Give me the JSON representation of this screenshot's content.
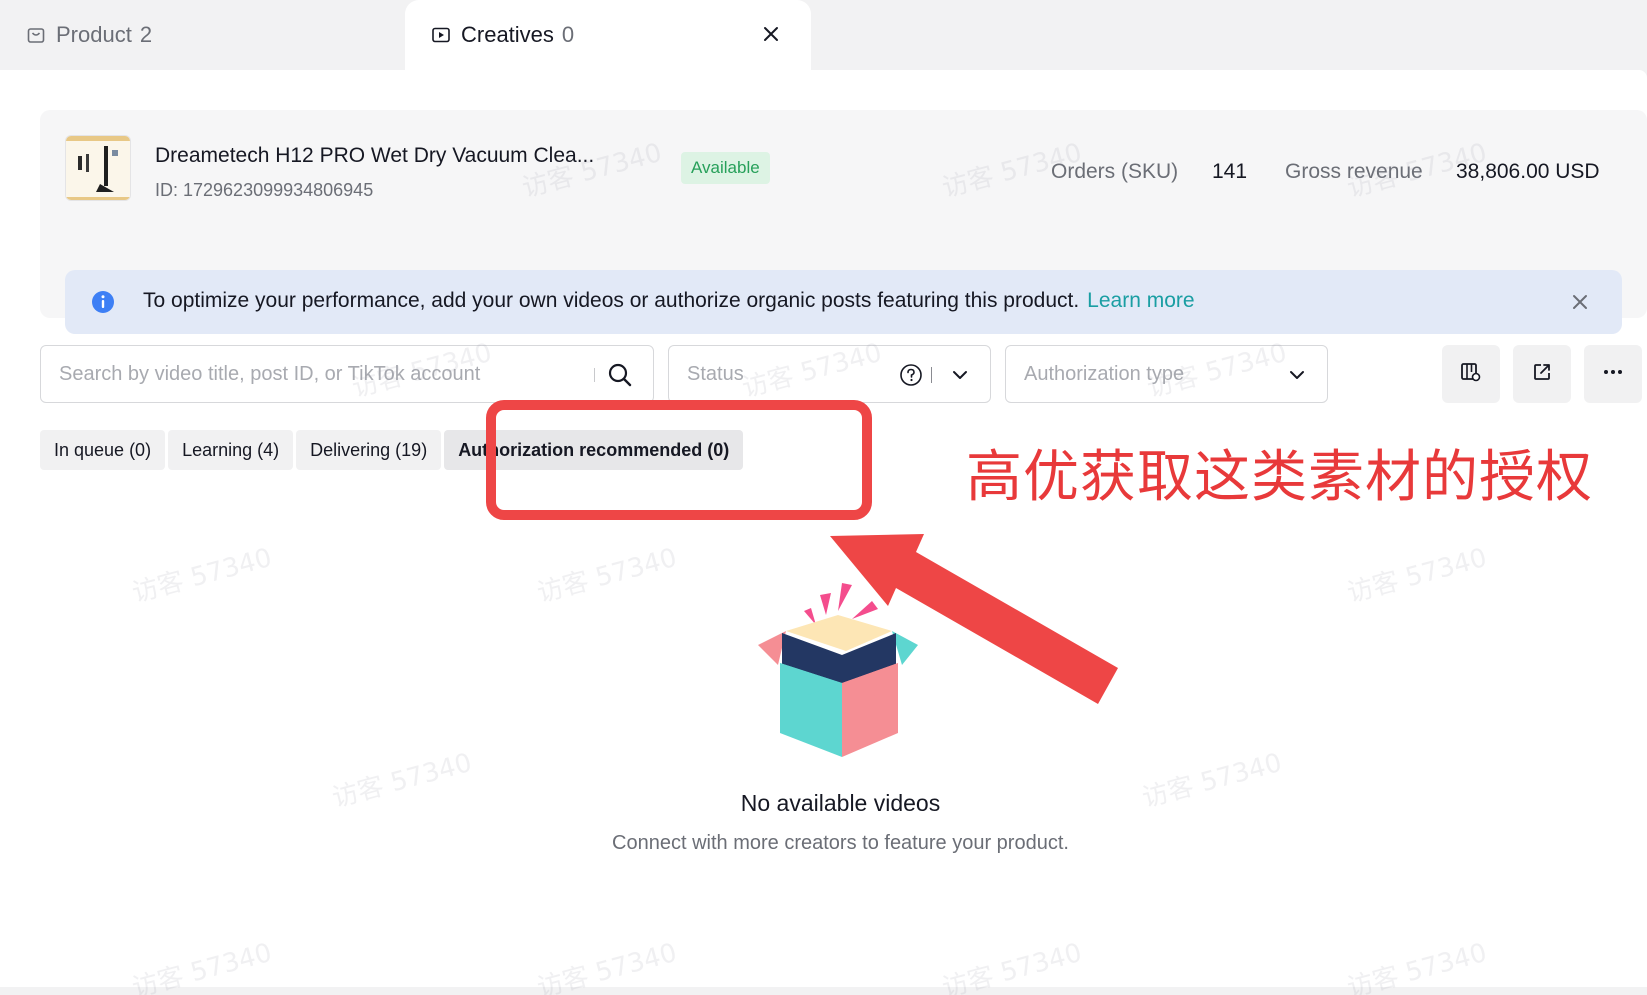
{
  "tabs": [
    {
      "label": "Product",
      "count": "2"
    },
    {
      "label": "Creatives",
      "count": "0"
    }
  ],
  "product": {
    "title": "Dreametech H12 PRO Wet Dry Vacuum Clea...",
    "id": "ID: 1729623099934806945",
    "status": "Available",
    "orders_label": "Orders (SKU)",
    "orders_value": "141",
    "revenue_label": "Gross revenue",
    "revenue_value": "38,806.00 USD"
  },
  "banner": {
    "text": "To optimize your performance, add your own videos or authorize organic posts featuring this product.",
    "link": "Learn more"
  },
  "filters": {
    "search_placeholder": "Search by video title, post ID, or TikTok account",
    "status_placeholder": "Status",
    "auth_placeholder": "Authorization type"
  },
  "status_tabs": [
    {
      "label": "In queue (0)"
    },
    {
      "label": "Learning (4)"
    },
    {
      "label": "Delivering (19)"
    },
    {
      "label": "Authorization recommended (0)"
    }
  ],
  "annotation": {
    "text": "高优获取这类素材的授权",
    "color": "#e8393a"
  },
  "empty_state": {
    "title": "No available videos",
    "subtitle": "Connect with more creators to feature your product."
  },
  "watermark": "访客 57340",
  "colors": {
    "accent_teal": "#1a9ea3",
    "available_green": "#27a05a",
    "info_blue": "#3d7ff5"
  }
}
